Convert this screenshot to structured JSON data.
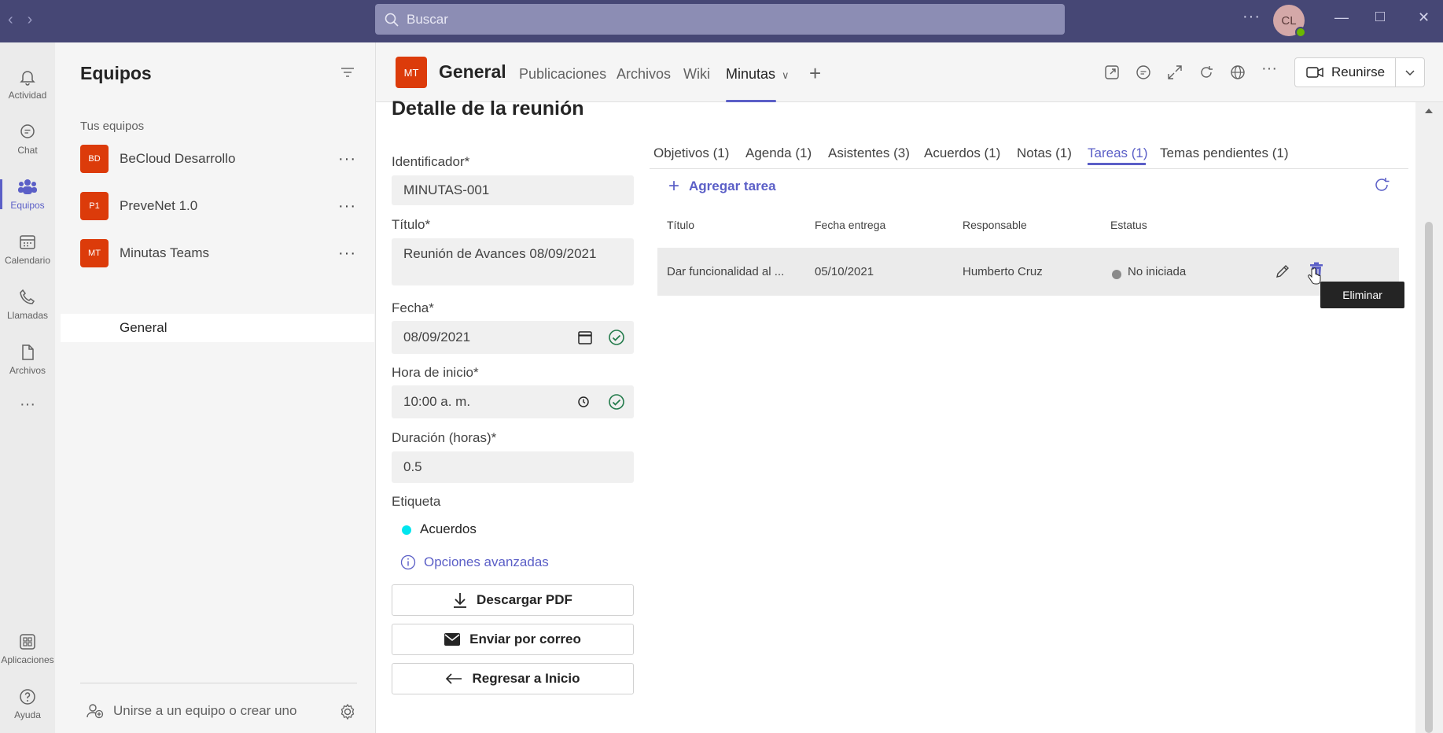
{
  "titlebar": {
    "search_placeholder": "Buscar",
    "more": "···",
    "avatar_initials": "CL"
  },
  "rail": {
    "items": [
      {
        "label": "Actividad",
        "icon": "bell-icon"
      },
      {
        "label": "Chat",
        "icon": "chat-icon"
      },
      {
        "label": "Equipos",
        "icon": "teams-icon",
        "active": true
      },
      {
        "label": "Calendario",
        "icon": "calendar-icon"
      },
      {
        "label": "Llamadas",
        "icon": "phone-icon"
      },
      {
        "label": "Archivos",
        "icon": "file-icon"
      },
      {
        "label": "Aplicaciones",
        "icon": "apps-icon"
      },
      {
        "label": "Ayuda",
        "icon": "help-icon"
      }
    ],
    "more": "···"
  },
  "teams": {
    "title": "Equipos",
    "section": "Tus equipos",
    "list": [
      {
        "initials": "BD",
        "name": "BeCloud Desarrollo"
      },
      {
        "initials": "P1",
        "name": "PreveNet 1.0"
      },
      {
        "initials": "MT",
        "name": "Minutas Teams"
      }
    ],
    "item_more": "···",
    "channel": "General",
    "join": "Unirse a un equipo o crear uno"
  },
  "channel": {
    "badge": "MT",
    "name": "General",
    "tabs": [
      "Publicaciones",
      "Archivos",
      "Wiki",
      "Minutas"
    ],
    "meet_label": "Reunirse"
  },
  "page": {
    "title": "Detalle de la reunión"
  },
  "form": {
    "id_label": "Identificador*",
    "id_value": "MINUTAS-001",
    "title_label": "Título*",
    "title_value": "Reunión  de Avances 08/09/2021",
    "date_label": "Fecha*",
    "date_value": "08/09/2021",
    "time_label": "Hora de inicio*",
    "time_value": "10:00  a. m.",
    "duration_label": "Duración (horas)*",
    "duration_value": "0.5",
    "tag_label": "Etiqueta",
    "tag_value": "Acuerdos",
    "tag_color": "#00e5ee",
    "advanced": "Opciones avanzadas",
    "btn_pdf": "Descargar PDF",
    "btn_email": "Enviar por correo",
    "btn_back": "Regresar a Inicio"
  },
  "subtabs": [
    "Objetivos (1)",
    "Agenda (1)",
    "Asistentes (3)",
    "Acuerdos (1)",
    "Notas (1)",
    "Tareas (1)",
    "Temas pendientes (1)"
  ],
  "tasks": {
    "add_label": "Agregar tarea",
    "columns": [
      "Título",
      "Fecha entrega",
      "Responsable",
      "Estatus"
    ],
    "rows": [
      {
        "title": "Dar funcionalidad al ...",
        "due": "05/10/2021",
        "owner": "Humberto Cruz",
        "status": "No iniciada"
      }
    ],
    "tooltip": "Eliminar"
  },
  "colors": {
    "accent": "#5b5fc7",
    "titlebar": "#464775",
    "team_badge": "#dc3b0a"
  }
}
